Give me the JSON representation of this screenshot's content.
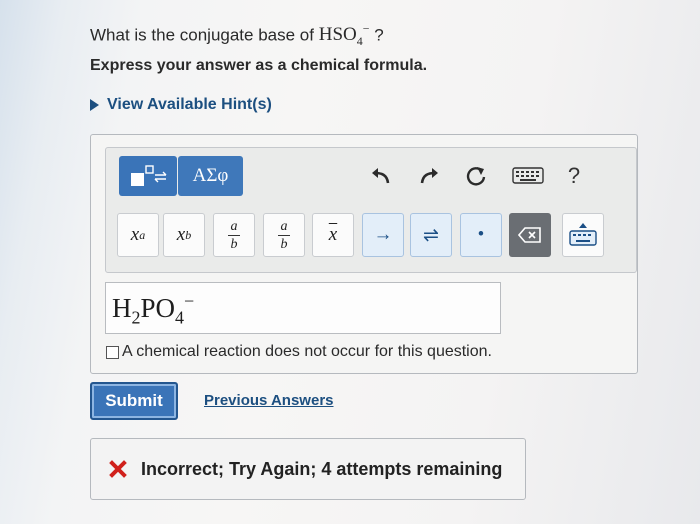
{
  "question": {
    "prefix": "What is the conjugate base of",
    "formula_main": "HSO",
    "formula_sub": "4",
    "formula_charge": "−",
    "suffix": "?"
  },
  "instruction": "Express your answer as a chemical formula.",
  "hint_link": "View Available Hint(s)",
  "toolbar": {
    "mode_templates_icon": "templates-icon",
    "mode_symbols_label": "ΑΣφ",
    "undo_icon": "undo-icon",
    "redo_icon": "redo-icon",
    "reset_icon": "reset-icon",
    "keyboard_icon": "keyboard-icon",
    "help_label": "?",
    "templates": [
      {
        "name": "superscript",
        "base": "x",
        "sup": "a"
      },
      {
        "name": "subscript",
        "base": "x",
        "sub": "b"
      },
      {
        "name": "fraction",
        "num": "a",
        "den": "b"
      },
      {
        "name": "mixed-fraction",
        "num": "a",
        "den": "b"
      },
      {
        "name": "overline",
        "base": "x"
      },
      {
        "name": "reaction-arrow",
        "glyph": "→"
      },
      {
        "name": "equilibrium-arrow",
        "glyph": "⇌"
      },
      {
        "name": "dot",
        "glyph": "•"
      }
    ]
  },
  "answer": {
    "p1": "H",
    "s1": "2",
    "p2": "PO",
    "s2": "4",
    "charge": "−"
  },
  "no_reaction_label": "A chemical reaction does not occur for this question.",
  "submit_label": "Submit",
  "previous_answers_label": "Previous Answers",
  "feedback": {
    "icon": "x-mark-icon",
    "icon_color": "#d0201b",
    "text": "Incorrect; Try Again; 4 attempts remaining"
  },
  "accent_color": "#3a74b8"
}
